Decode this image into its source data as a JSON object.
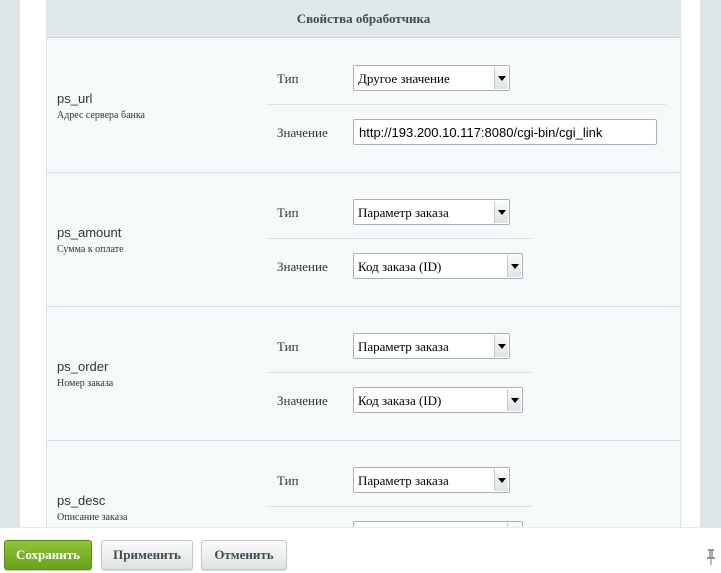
{
  "header": {
    "title": "Свойства обработчика"
  },
  "properties": [
    {
      "name": "ps_url",
      "description": "Адрес сервера банка",
      "type_label": "Тип",
      "type_value": "Другое значение",
      "value_label": "Значение",
      "value": "http://193.200.10.117:8080/cgi-bin/cgi_link",
      "value_kind": "text"
    },
    {
      "name": "ps_amount",
      "description": "Сумма к оплате",
      "type_label": "Тип",
      "type_value": "Параметр заказа",
      "value_label": "Значение",
      "value": "Код заказа (ID)",
      "value_kind": "select"
    },
    {
      "name": "ps_order",
      "description": "Номер заказа",
      "type_label": "Тип",
      "type_value": "Параметр заказа",
      "value_label": "Значение",
      "value": "Код заказа (ID)",
      "value_kind": "select"
    },
    {
      "name": "ps_desc",
      "description": "Описание заказа",
      "type_label": "Тип",
      "type_value": "Параметр заказа",
      "value_label": "",
      "value": "",
      "value_kind": "select"
    }
  ],
  "footer": {
    "save_label": "Сохранить",
    "apply_label": "Применить",
    "cancel_label": "Отменить",
    "pin_icon": "pin-icon"
  },
  "colors": {
    "save_button": "#7ab32a",
    "header_bg": "#e0e8ea",
    "panel_bg": "#f5f9f9"
  }
}
